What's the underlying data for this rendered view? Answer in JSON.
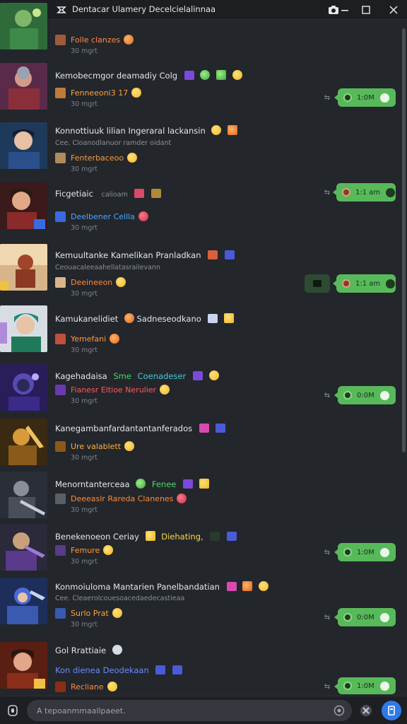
{
  "window": {
    "title": "Dentacar Ulamery Decelcielalinnaa"
  },
  "composer": {
    "placeholder": "A tepoanmmaallpaeet."
  },
  "messages": [
    {
      "text": "",
      "sub": "",
      "user": "Folle clanzes",
      "user_color": "#ff8a4a",
      "time": "30 mgrt"
    },
    {
      "text": "Kemobecmgor deamadiy Colg",
      "sub": "",
      "user": "Fenneeoni3 17",
      "user_color": "#ffa33a",
      "time": "30 mgrt",
      "bubble": "1:0M"
    },
    {
      "text": "Konnottiuuk lilian Ingeraral lackansin",
      "sub": "Cee. Cloanodlanuor ramder oidant",
      "user": "Fenterbaceoo",
      "user_color": "#ff9a3a",
      "time": "30 mgrt"
    },
    {
      "text": "Ficgetiaic",
      "sub": "",
      "user": "Deelbener Cellla",
      "user_color": "#4aa8ff",
      "time": "30 mgrt",
      "bubble": "1:1 am"
    },
    {
      "text": "Kemuultanke Kamelikan Pranladkan",
      "sub": "Ceouacaleeaahellatasrailevann",
      "user": "Deeineeon",
      "user_color": "#ff8a3a",
      "time": "30 mgrt",
      "bubble": "1:1 am"
    },
    {
      "text": "Kamukanelidiet",
      "sub": "",
      "user": "Yemefani",
      "user_color": "#ff9a3a",
      "time": "30 mgrt"
    },
    {
      "text": "Kagehadaisa",
      "sub": "",
      "user": "Fianesr Eltioe Nerulier",
      "user_color": "#ff5a5a",
      "time": "30 mgrt",
      "bubble": "0:0M"
    },
    {
      "text": "Kanegambanfardantantanferados",
      "sub": "",
      "user": "Ure valablett",
      "user_color": "#ffb03a",
      "time": "30 mgrt"
    },
    {
      "text": "Menorntanterceaa",
      "sub": "",
      "user": "Deeeaslr Rareda Clanenes",
      "user_color": "#ff8a3a",
      "time": "30 mgrt"
    },
    {
      "text": "Benekenoeon Ceriay",
      "sub": "",
      "user": "Femure",
      "user_color": "#ff9a3a",
      "time": "30 mgrt",
      "bubble": "1:0M"
    },
    {
      "text": "Konmoiuloma Mantarien Panelbandatian",
      "sub": "Cee. Cleaerolcouesoacedaedecastieaa",
      "user": "Surlo Prat",
      "user_color": "#ffa33a",
      "time": "30 mgrt",
      "bubble": "0:0M"
    },
    {
      "text": "Gol Rrattiaie",
      "sub": "Kon dienea Deodekaan",
      "user": "Recliane",
      "user_color": "#ff8a3a",
      "time": "30 mgrt",
      "bubble": "1:0M"
    }
  ],
  "inline": {
    "m6_green": "Sme",
    "m6_blue": "Coenadeser",
    "m5_yel": "Sadneseodkano",
    "m9_green": "Fenee",
    "m10_yel": "Diehating,",
    "m4_time_alt": "calioam"
  },
  "colors": {
    "bubble_green": "#58b95a",
    "background": "#23262b",
    "titlebar": "#1c1e22"
  },
  "icons": {
    "app": "app-logo-icon",
    "screenshot": "camera-icon",
    "maximize": "maximize-icon",
    "close": "close-icon",
    "attach": "attachment-icon",
    "emoji": "emoji-icon",
    "send": "send-icon"
  }
}
